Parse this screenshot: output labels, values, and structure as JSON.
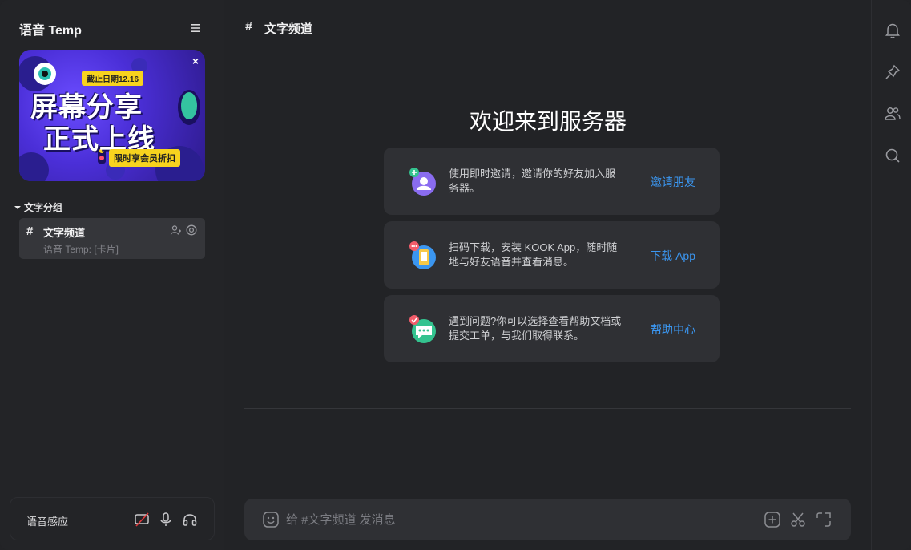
{
  "sidebar": {
    "server_title": "语音 Temp",
    "banner": {
      "deadline": "截止日期12.16",
      "line1": "屏幕分享",
      "line2": "正式上线",
      "promo": "限时享会员折扣",
      "close": "×"
    },
    "group": {
      "label": "文字分组"
    },
    "channel": {
      "hash": "#",
      "name": "文字频道",
      "subtitle": "语音 Temp: [卡片]"
    },
    "voice": {
      "label": "语音感应"
    }
  },
  "main": {
    "channel_hash": "#",
    "channel_title": "文字频道",
    "welcome": "欢迎来到服务器",
    "cards": [
      {
        "text": "使用即时邀请，邀请你的好友加入服务器。",
        "action": "邀请朋友"
      },
      {
        "text": "扫码下载，安装 KOOK App，随时随地与好友语音并查看消息。",
        "action": "下载 App"
      },
      {
        "text": "遇到问题?你可以选择查看帮助文档或提交工单，与我们取得联系。",
        "action": "帮助中心"
      }
    ],
    "input": {
      "placeholder": "给 #文字频道 发消息"
    }
  },
  "colors": {
    "accent": "#3b96f0",
    "bg": "#222326",
    "card": "#2f3034"
  }
}
